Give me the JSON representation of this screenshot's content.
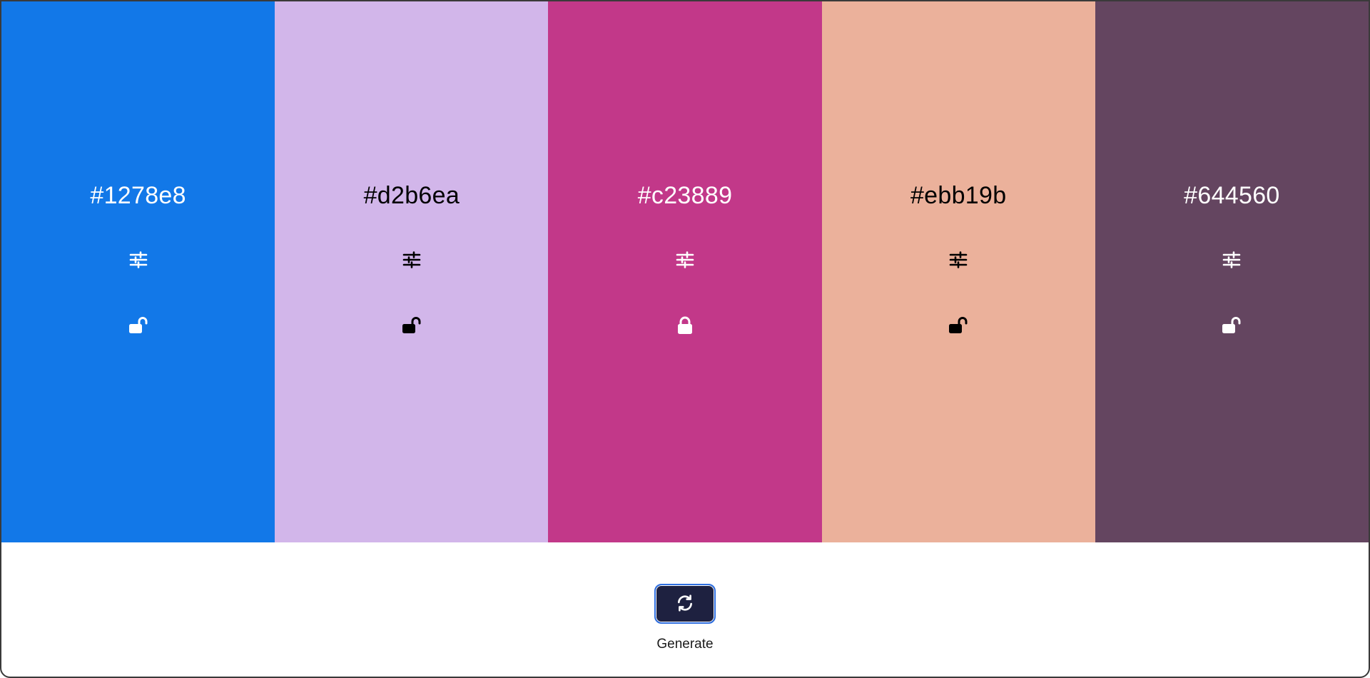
{
  "palette": {
    "swatches": [
      {
        "hex": "#1278e8",
        "text_color": "#ffffff",
        "locked": false,
        "lock_icon": "lock-open-icon",
        "adjust_icon": "sliders-icon"
      },
      {
        "hex": "#d2b6ea",
        "text_color": "#000000",
        "locked": false,
        "lock_icon": "lock-open-icon",
        "adjust_icon": "sliders-icon"
      },
      {
        "hex": "#c23889",
        "text_color": "#ffffff",
        "locked": true,
        "lock_icon": "lock-closed-icon",
        "adjust_icon": "sliders-icon"
      },
      {
        "hex": "#ebb19b",
        "text_color": "#000000",
        "locked": false,
        "lock_icon": "lock-open-icon",
        "adjust_icon": "sliders-icon"
      },
      {
        "hex": "#644560",
        "text_color": "#ffffff",
        "locked": false,
        "lock_icon": "lock-open-icon",
        "adjust_icon": "sliders-icon"
      }
    ]
  },
  "controls": {
    "generate_label": "Generate",
    "generate_icon": "refresh-icon",
    "button_color": "#1e2140",
    "button_border_color": "#2f6fe0"
  }
}
